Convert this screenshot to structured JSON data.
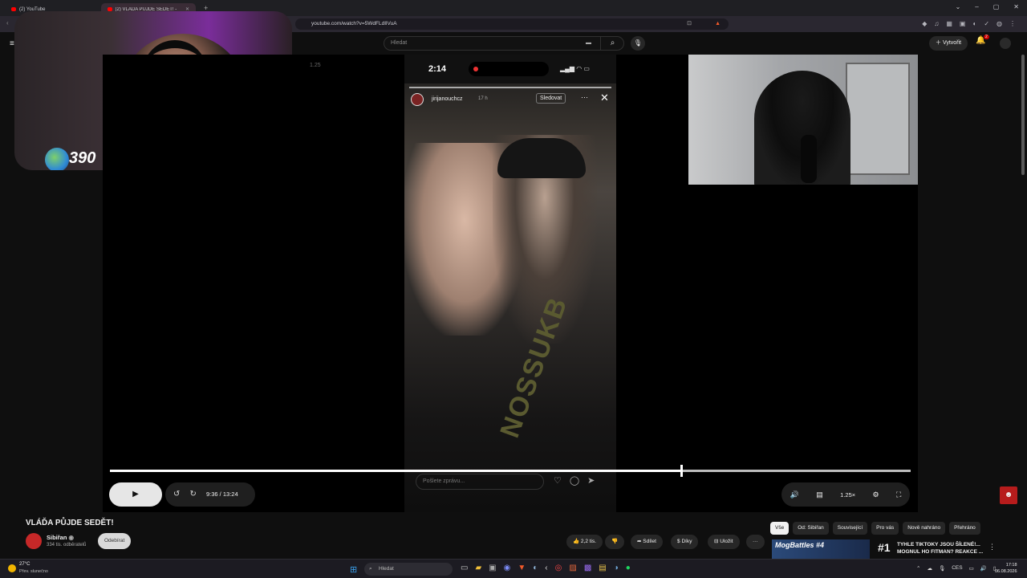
{
  "browser": {
    "tabs": [
      {
        "label": "(2) YouTube",
        "active": false
      },
      {
        "label": "(2) VLÁĎA PŮJDE SEDĚT! - Yo",
        "active": true
      }
    ],
    "new_tab": "+",
    "url": "youtube.com/watch?v=5WdFLdIlVuA",
    "window_controls": [
      "⌄",
      "–",
      "▢",
      "✕"
    ],
    "extensions": [
      "◆",
      "♫",
      "▦",
      "▣",
      "◐",
      "✓",
      "◍",
      "⋮"
    ]
  },
  "youtube": {
    "search_placeholder": "Hledat",
    "create_label": "Vytvořit",
    "notification_count": "2"
  },
  "player": {
    "speed_overlay": "1.25",
    "phone": {
      "time": "2:14",
      "username": "jirijanouchcz",
      "story_age": "17 h",
      "follow_label": "Sledovat",
      "shirt_text": "NOSSUKB",
      "message_placeholder": "Pošlete zprávu..."
    },
    "streamer_subs": "390",
    "current_time": "9:36",
    "separator": "/",
    "duration": "13:24",
    "progress": 0.713,
    "speed": "1.25×"
  },
  "video": {
    "title": "VLÁĎA PŮJDE SEDĚT!",
    "channel_name": "Sibiřan",
    "channel_subs": "334 tis. odběratelů",
    "subscribe_label": "Odebírat",
    "likes": "2,2 tis.",
    "share_label": "Sdílet",
    "thanks_label": "Díky",
    "save_label": "Uložit",
    "more_label": "···"
  },
  "chips": [
    "Vše",
    "Od: Sibiřan",
    "Související",
    "Pro vás",
    "Nově nahráno",
    "Přehráno"
  ],
  "recommendation": {
    "thumb_text": "MogBattles #4",
    "rank": "#1",
    "title": "TYHLE TIKTOKY JSOU ŠÍLENÉ!... MOGNUL HO FITMAN? REAKCE ..."
  },
  "taskbar": {
    "temp": "27°C",
    "weather": "Přev. slunečno",
    "search_label": "Hledat",
    "lang": "CES",
    "time": "17:18",
    "date": "06.08.2026"
  }
}
